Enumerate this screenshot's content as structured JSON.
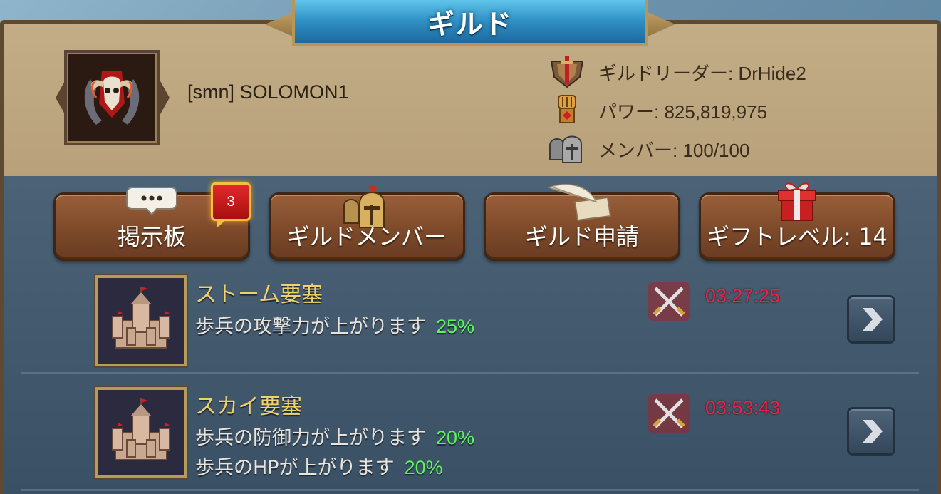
{
  "title": "ギルド",
  "guild": {
    "name": "[smn] SOLOMON1",
    "leader_text": "ギルドリーダー: DrHide2",
    "power_text": "パワー: 825,819,975",
    "members_text": "メンバー: 100/100"
  },
  "icons": {
    "emblem": "ram-skull-emblem-icon",
    "leader": "shield-sword-icon",
    "power": "fist-icon",
    "members": "helmets-icon"
  },
  "buttons": [
    {
      "label": "掲示板",
      "icon": "speech-bubble-icon",
      "badge": "3"
    },
    {
      "label": "ギルドメンバー",
      "icon": "spartan-helmet-icon"
    },
    {
      "label": "ギルド申請",
      "icon": "quill-scroll-icon"
    },
    {
      "label": "ギフトレベル: 14",
      "icon": "gift-box-icon"
    }
  ],
  "fortresses": [
    {
      "name": "ストーム要塞",
      "buffs": [
        {
          "text": "歩兵の攻撃力が上がります",
          "pct": "25%"
        }
      ],
      "timer": "03:27:25"
    },
    {
      "name": "スカイ要塞",
      "buffs": [
        {
          "text": "歩兵の防御力が上がります",
          "pct": "20%"
        },
        {
          "text": "歩兵のHPが上がります",
          "pct": "20%"
        }
      ],
      "timer": "03:53:43"
    }
  ],
  "colors": {
    "title_blue": "#2f8fc4",
    "header_tan": "#c2ad86",
    "button_brown": "#7d4a2a",
    "fort_name_yellow": "#f0d26a",
    "pct_green": "#5cf55c",
    "timer_red": "#f0204a",
    "badge_red": "#e22a2a"
  }
}
